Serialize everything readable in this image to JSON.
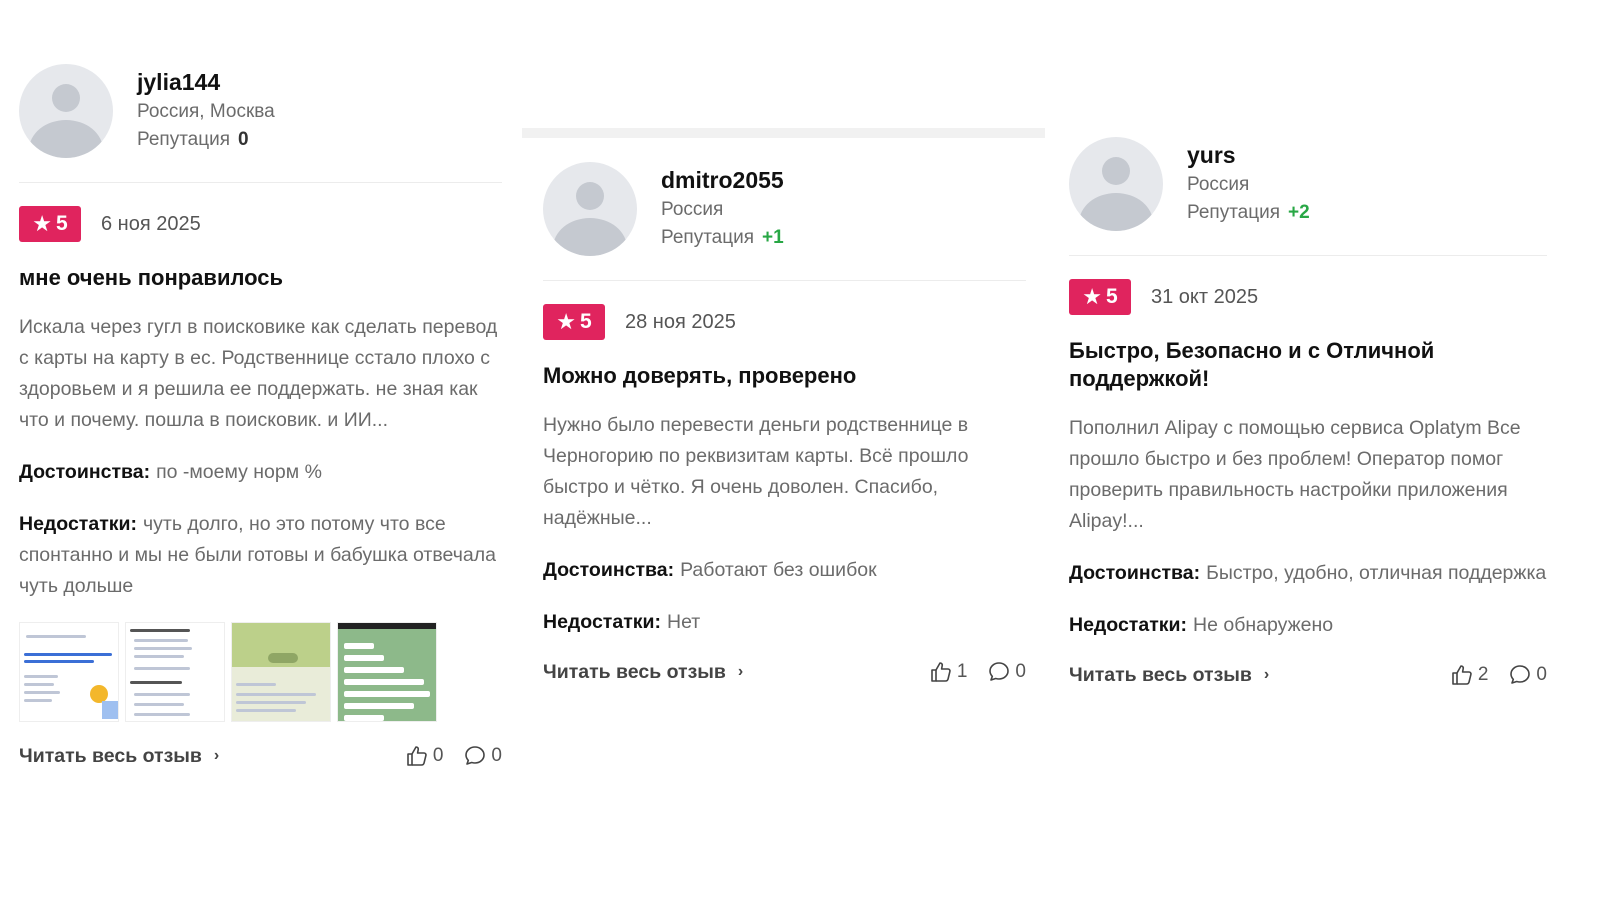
{
  "reviews": [
    {
      "username": "jylia144",
      "location": "Россия, Москва",
      "reputation_label": "Репутация",
      "reputation_value": "0",
      "rating": "5",
      "date": "6 ноя 2025",
      "title": "мне очень понравилось",
      "text": "Искала через гугл в поисковике как сделать перевод с карты на карту в ес. Родственнице сстало плохо с здоровьем и я решила ее поддержать. не зная как что и почему. пошла в поисковик. и ИИ...",
      "pros_label": "Достоинства:",
      "pros": "по -моему норм %",
      "cons_label": "Недостатки:",
      "cons": "чуть долго, но это потому что все спонтанно и мы не были готовы и бабушка отвечала чуть дольше",
      "read_more": "Читать весь отзыв",
      "likes": "0",
      "comments": "0"
    },
    {
      "username": "dmitro2055",
      "location": "Россия",
      "reputation_label": "Репутация",
      "reputation_value": "+1",
      "rating": "5",
      "date": "28 ноя 2025",
      "title": "Можно доверять, проверено",
      "text": "Нужно было перевести деньги родственнице в Черногорию по реквизитам карты. Всё прошло быстро и чётко. Я очень доволен. Спасибо, надёжные...",
      "pros_label": "Достоинства:",
      "pros": "Работают без ошибок",
      "cons_label": "Недостатки:",
      "cons": "Нет",
      "read_more": "Читать весь отзыв",
      "likes": "1",
      "comments": "0"
    },
    {
      "username": "yurs",
      "location": "Россия",
      "reputation_label": "Репутация",
      "reputation_value": "+2",
      "rating": "5",
      "date": "31 окт 2025",
      "title": "Быстро, Безопасно и с Отличной поддержкой!",
      "text": "Пополнил Alipay с помощью сервиса Oplatym Все прошло быстро и без проблем! Оператор помог проверить правильность настройки приложения Alipay!...",
      "pros_label": "Достоинства:",
      "pros": "Быстро, удобно, отличная поддержка",
      "cons_label": "Недостатки:",
      "cons": "Не обнаружено",
      "read_more": "Читать весь отзыв",
      "likes": "2",
      "comments": "0"
    }
  ],
  "icons": {
    "star": "star-icon",
    "like": "thumbs-up-icon",
    "comment": "comment-icon",
    "chevron": "chevron-right-icon"
  },
  "colors": {
    "rating_badge": "#e0245e",
    "reputation_positive": "#28a745"
  }
}
